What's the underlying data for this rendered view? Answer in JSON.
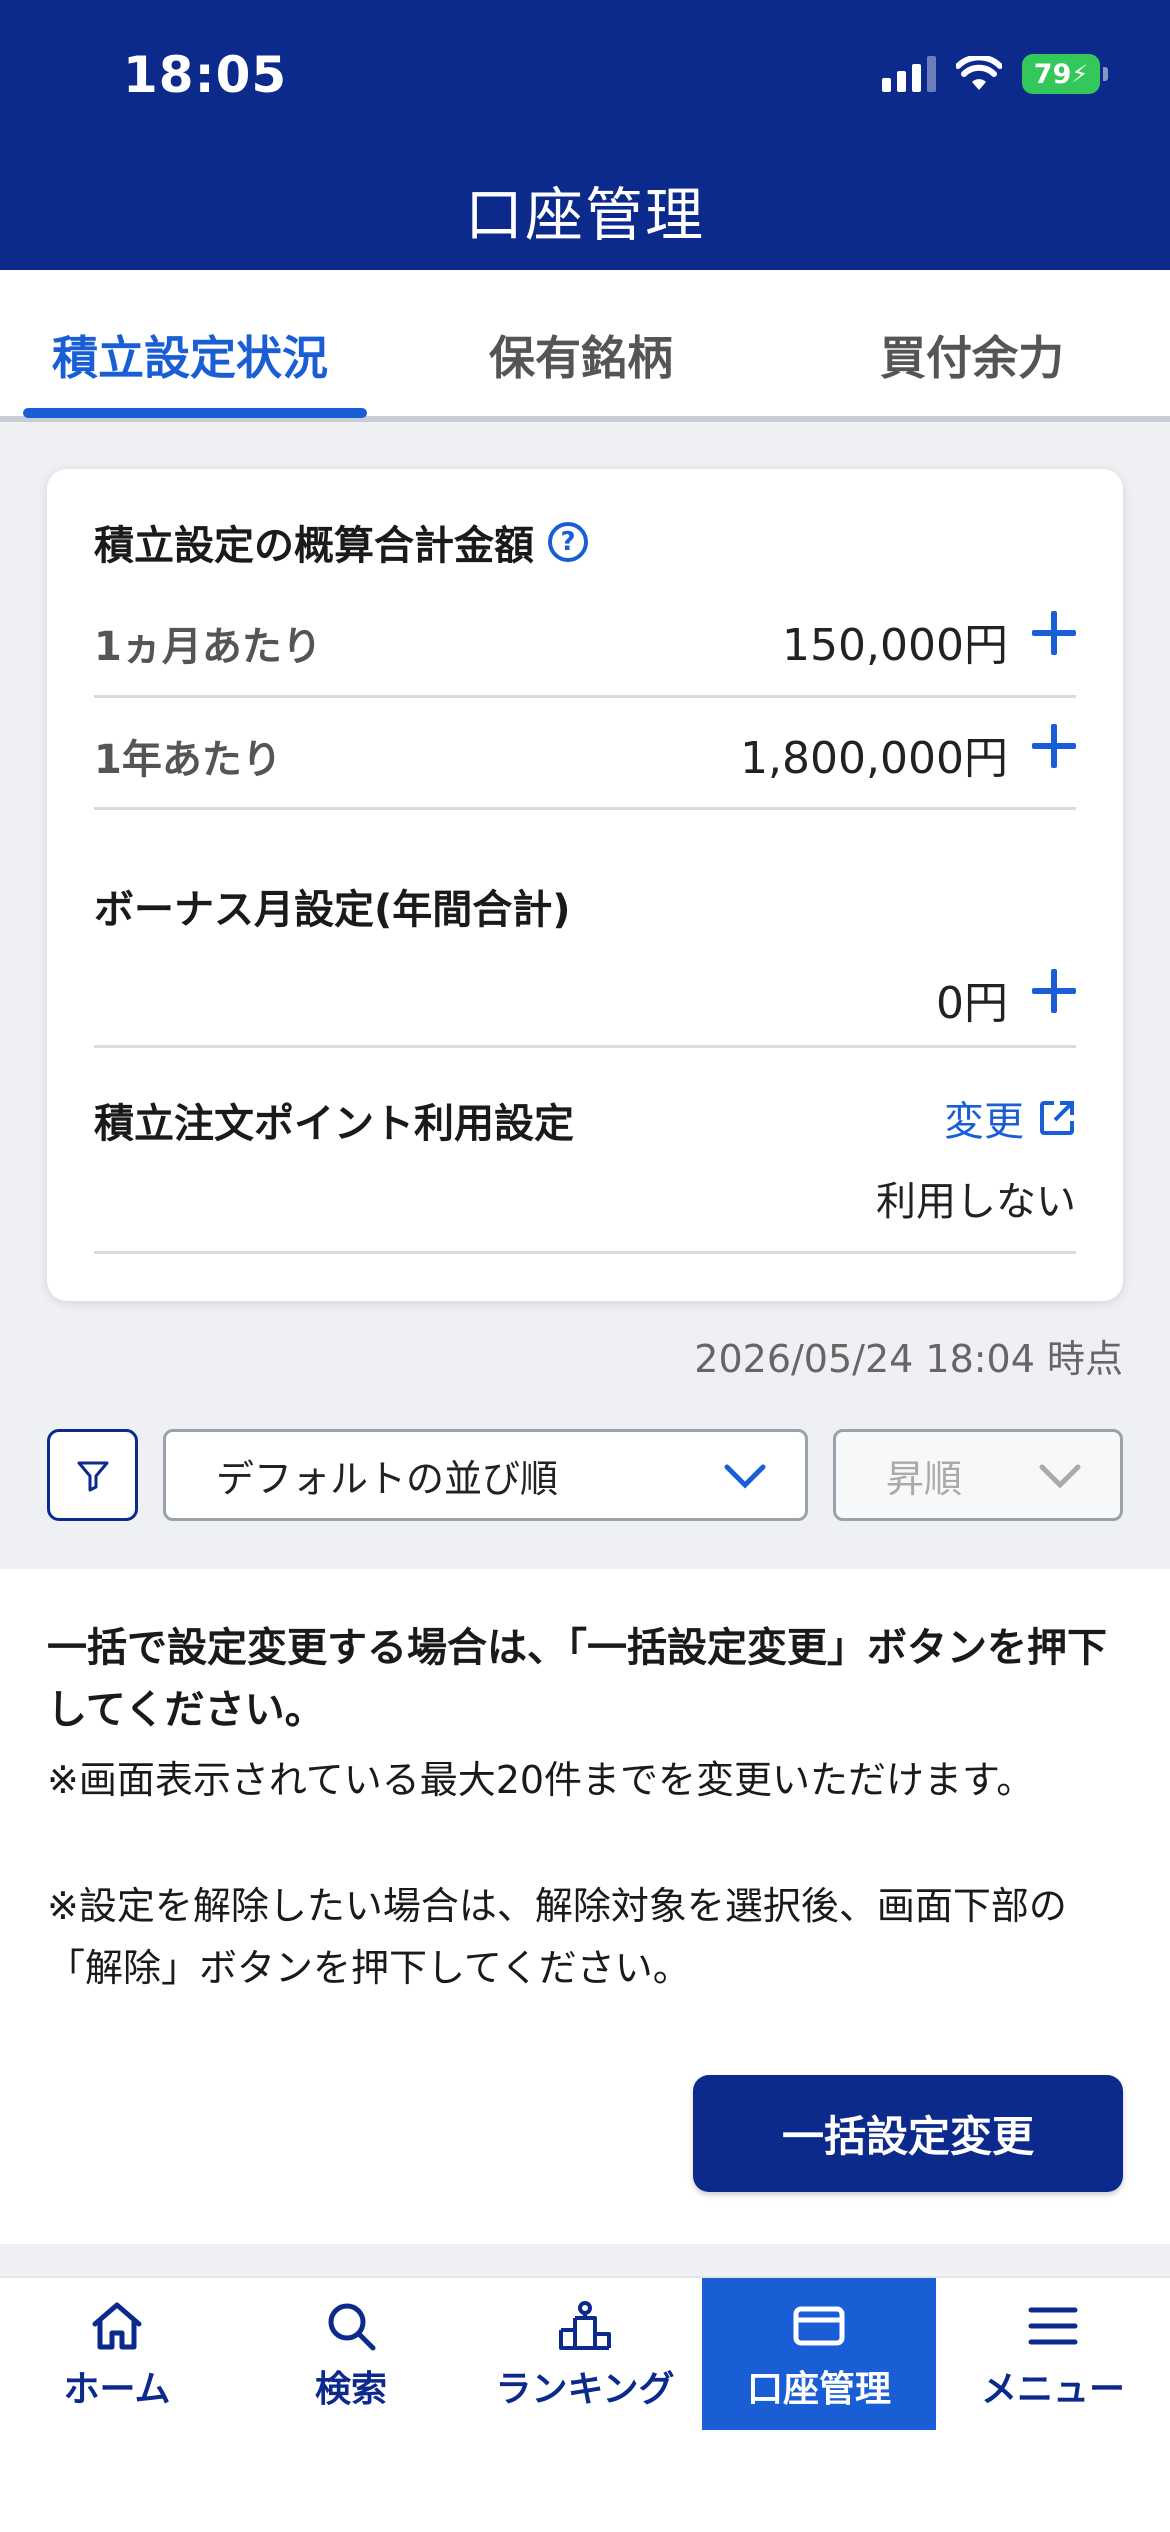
{
  "status_bar": {
    "time": "18:05",
    "battery": "79"
  },
  "header": {
    "title": "口座管理"
  },
  "tabs": [
    {
      "label": "積立設定状況"
    },
    {
      "label": "保有銘柄"
    },
    {
      "label": "買付余力"
    }
  ],
  "summary": {
    "title": "積立設定の概算合計金額",
    "help_icon": "?",
    "monthly": {
      "label": "1ヵ月あたり",
      "value": "150,000円"
    },
    "yearly": {
      "label": "1年あたり",
      "value": "1,800,000円"
    },
    "bonus": {
      "label": "ボーナス月設定(年間合計)",
      "value": "0円"
    },
    "points": {
      "label": "積立注文ポイント利用設定",
      "link": "変更",
      "value": "利用しない"
    }
  },
  "timestamp": "2026/05/24 18:04 時点",
  "sort": {
    "order_value": "デフォルトの並び順",
    "direction_value": "昇順"
  },
  "info": {
    "bold": "一括で設定変更する場合は、「一括設定変更」ボタンを押下してください。",
    "note1": "※画面表示されている最大20件までを変更いただけます。",
    "note2": "※設定を解除したい場合は、解除対象を選択後、画面下部の「解除」ボタンを押下してください。",
    "button": "一括設定変更"
  },
  "nav": [
    {
      "label": "ホーム",
      "icon": "home-icon"
    },
    {
      "label": "検索",
      "icon": "search-icon"
    },
    {
      "label": "ランキング",
      "icon": "ranking-icon"
    },
    {
      "label": "口座管理",
      "icon": "card-icon"
    },
    {
      "label": "メニュー",
      "icon": "menu-icon"
    }
  ],
  "colors": {
    "primary": "#0b2a8c",
    "accent": "#1a5ed6",
    "battery": "#34c759"
  }
}
